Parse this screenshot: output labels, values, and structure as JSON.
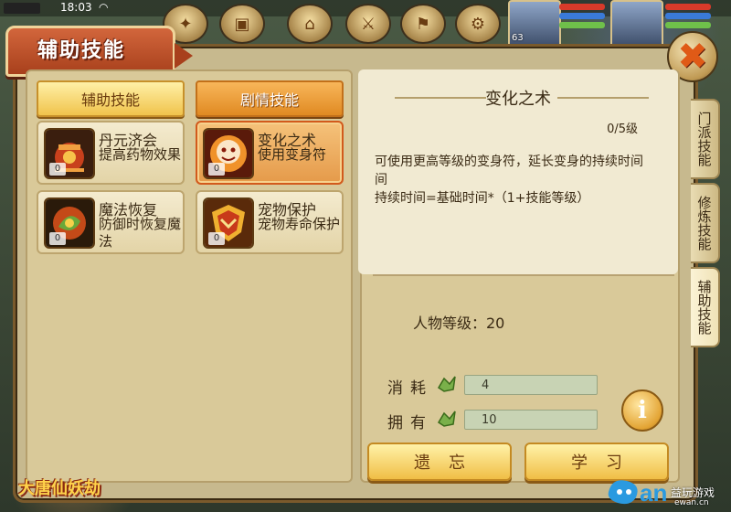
{
  "status": {
    "time": "18:03"
  },
  "header": {
    "title": "辅助技能",
    "close_icon": "close-x-icon"
  },
  "hud": {
    "hero_level": "63"
  },
  "tabs": [
    {
      "label": "辅助技能",
      "active": true
    },
    {
      "label": "剧情技能",
      "active": false
    }
  ],
  "skills": [
    {
      "name": "丹元济会",
      "desc": "提高药物效果",
      "level": "0",
      "icon": "elixir-cauldron-icon",
      "selected": false
    },
    {
      "name": "变化之术",
      "desc": "使用变身符",
      "level": "0",
      "icon": "transformation-mask-icon",
      "selected": true
    },
    {
      "name": "魔法恢复",
      "desc": "防御时恢复魔法",
      "level": "0",
      "icon": "magic-restore-icon",
      "selected": false
    },
    {
      "name": "宠物保护",
      "desc": "宠物寿命保护",
      "level": "0",
      "icon": "pet-shield-icon",
      "selected": false
    }
  ],
  "detail": {
    "title": "变化之术",
    "level": "0/5级",
    "description_line1": "可使用更高等级的变身符，延长变身的持续时间",
    "description_line2": "间",
    "description_line3": "持续时间=基础时间*（1+技能等级）",
    "char_level_label": "人物等级：20",
    "cost_label": "消耗",
    "cost_value": "4",
    "own_label": "拥有",
    "own_value": "10",
    "forget_label": "遗忘",
    "learn_label": "学习"
  },
  "side_tabs": [
    {
      "label": "门派技能",
      "active": false
    },
    {
      "label": "修炼技能",
      "active": false
    },
    {
      "label": "辅助技能",
      "active": true
    }
  ],
  "branding": {
    "game_logo": "大唐仙妖劫",
    "watermark": "益玩游戏",
    "watermark_sub": "ewan.cn"
  },
  "colors": {
    "window_bg": "#c7b98e",
    "title_tab": "#d2663c",
    "selected_card": "#e59a4a",
    "button_gold": "#f0be46"
  }
}
